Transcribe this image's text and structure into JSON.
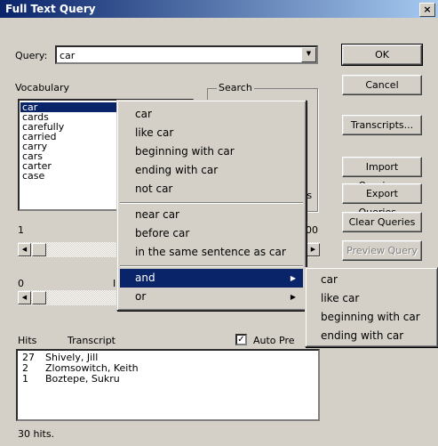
{
  "window": {
    "title": "Full Text Query",
    "close_glyph": "×"
  },
  "query": {
    "label": "Query:",
    "value": "car"
  },
  "buttons": {
    "ok": "OK",
    "cancel": "Cancel",
    "transcripts": "Transcripts...",
    "import": "Import Queries...",
    "export": "Export Queries...",
    "clear": "Clear Queries",
    "preview": "Preview Query"
  },
  "vocabulary": {
    "label": "Vocabulary",
    "items": [
      "car",
      "cards",
      "carefully",
      "carried",
      "carry",
      "cars",
      "carter",
      "case"
    ],
    "selected": "car"
  },
  "search_group": {
    "label": "Search",
    "fragment": "ts"
  },
  "slider1": {
    "min": "1",
    "max_fragment": "00"
  },
  "slider2": {
    "min": "0",
    "mid_fragment": "I"
  },
  "hits_table": {
    "headers": {
      "hits": "Hits",
      "transcript": "Transcript"
    },
    "rows": [
      {
        "hits": "27",
        "transcript": "Shively, Jill"
      },
      {
        "hits": "2",
        "transcript": "Zlomsowitch, Keith"
      },
      {
        "hits": "1",
        "transcript": "Boztepe, Sukru"
      }
    ]
  },
  "auto_preview": {
    "label": "Auto Pre",
    "checked": true
  },
  "status": "30 hits.",
  "context_menu": {
    "group1": [
      "car",
      "like car",
      "beginning with car",
      "ending with car",
      "not car"
    ],
    "group2": [
      "near car",
      "before car",
      "in the same sentence as car"
    ],
    "group3": [
      "and",
      "or"
    ],
    "highlighted": "and"
  },
  "submenu": {
    "items": [
      "car",
      "like car",
      "beginning with car",
      "ending with car"
    ]
  },
  "colors": {
    "highlight": "#0a246a",
    "face": "#d4d0c8"
  }
}
